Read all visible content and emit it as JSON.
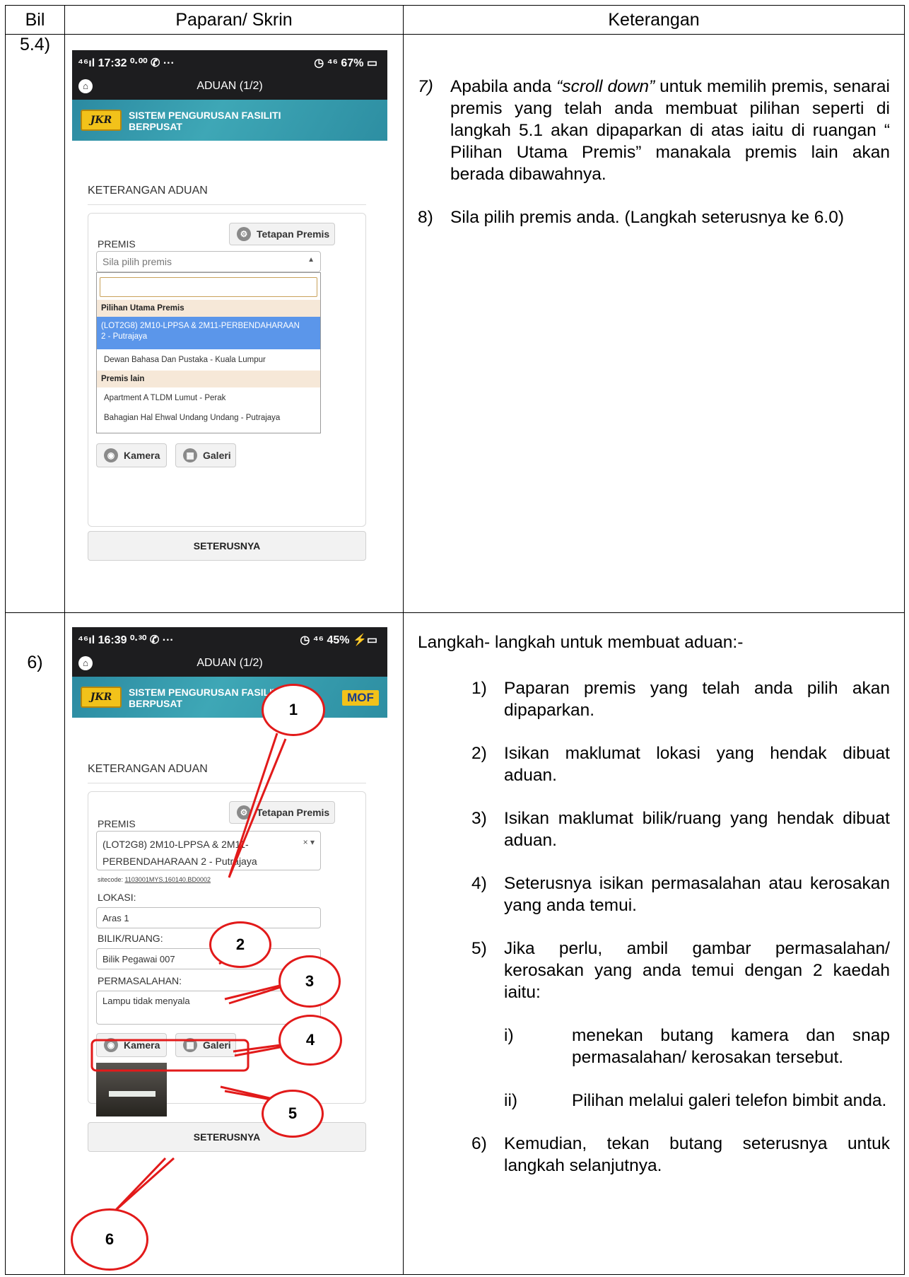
{
  "table": {
    "headers": [
      "Bil",
      "Paparan/ Skrin",
      "Keterangan"
    ]
  },
  "row1": {
    "bil": "5.4)",
    "phone": {
      "status_left": "⁴⁶ıl 17:32 ⁰·⁰⁰ ✆ ···",
      "status_right": "◷ ⁴⁶ 67% ▭",
      "title": "ADUAN (1/2)",
      "banner_logo": "JKR",
      "banner_title_1": "SISTEM PENGURUSAN FASILITI",
      "banner_title_2": "BERPUSAT",
      "section_title": "KETERANGAN ADUAN",
      "tetapan_label": "Tetapan Premis",
      "premis_label": "PREMIS",
      "select_placeholder": "Sila pilih premis",
      "group_primary": "Pilihan Utama Premis",
      "option_selected_1": "(LOT2G8) 2M10-LPPSA & 2M11-PERBENDAHARAAN",
      "option_selected_2": "2 - Putrajaya",
      "option_2": "Dewan Bahasa Dan Pustaka - Kuala Lumpur",
      "group_other": "Premis lain",
      "option_3": "Apartment A TLDM Lumut - Perak",
      "option_4": "Bahagian Hal Ehwal Undang Undang - Putrajaya",
      "kamera_label": "Kamera",
      "galeri_label": "Galeri",
      "next_label": "SETERUSNYA"
    },
    "desc": {
      "item7_num": "7)",
      "item7_a": "Apabila anda ",
      "item7_em": "“scroll down”",
      "item7_b": " untuk memilih premis, senarai premis yang telah anda membuat pilihan seperti di langkah 5.1 akan dipaparkan di atas iaitu di ruangan “ Pilihan Utama Premis” manakala premis lain akan berada dibawahnya.",
      "item8_num": "8)",
      "item8": "Sila pilih premis anda. (Langkah seterusnya ke 6.0)"
    }
  },
  "row2": {
    "bil": "6)",
    "phone": {
      "status_left": "⁴⁶ıl 16:39 ⁰·³⁰ ✆ ···",
      "status_right": "◷ ⁴⁶ 45% ⚡▭",
      "title": "ADUAN (1/2)",
      "banner_logo": "JKR",
      "banner_title_1": "SISTEM PENGURUSAN FASILITI",
      "banner_title_2": "BERPUSAT",
      "mof_logo": "MOF",
      "section_title": "KETERANGAN ADUAN",
      "tetapan_label": "Tetapan Premis",
      "premis_label": "PREMIS",
      "premis_value_1": "(LOT2G8) 2M10-LPPSA & 2M11-",
      "premis_value_2": "PERBENDAHARAAN 2 - Putrajaya",
      "sitecode_prefix": "sitecode: ",
      "sitecode": "1103001MYS.160140.BD0002",
      "lokasi_label": "LOKASI:",
      "lokasi_value": "Aras 1",
      "bilik_label": "BILIK/RUANG:",
      "bilik_value": "Bilik Pegawai 007",
      "masalah_label": "PERMASALAHAN:",
      "masalah_value": "Lampu tidak menyala",
      "kamera_label": "Kamera",
      "galeri_label": "Galeri",
      "next_label": "SETERUSNYA"
    },
    "callouts": [
      "1",
      "2",
      "3",
      "4",
      "5",
      "6"
    ],
    "desc": {
      "intro": "Langkah- langkah untuk membuat aduan:-",
      "items": [
        {
          "num": "1)",
          "text": "Paparan premis yang telah anda pilih akan dipaparkan."
        },
        {
          "num": "2)",
          "text": "Isikan maklumat lokasi yang hendak dibuat aduan."
        },
        {
          "num": "3)",
          "text": "Isikan maklumat bilik/ruang yang hendak dibuat aduan."
        },
        {
          "num": "4)",
          "text": "Seterusnya isikan permasalahan atau kerosakan yang anda temui."
        },
        {
          "num": "5)",
          "text": "Jika perlu, ambil gambar permasalahan/ kerosakan yang anda temui dengan 2 kaedah iaitu:"
        },
        {
          "num": "6)",
          "text": "Kemudian, tekan butang seterusnya untuk langkah selanjutnya."
        }
      ],
      "sub": [
        {
          "num": "i)",
          "text": "menekan butang kamera dan snap permasalahan/ kerosakan tersebut."
        },
        {
          "num": "ii)",
          "text": "Pilihan melalui galeri telefon bimbit anda."
        }
      ]
    }
  },
  "colors": {
    "callout_red": "#e21a1a",
    "banner_teal": "#2b8aa1",
    "selected_blue": "#5b96ea",
    "jkr_yellow": "#f2c21a"
  },
  "icons": [
    "home-icon",
    "gear-icon",
    "camera-icon",
    "grid-icon"
  ]
}
